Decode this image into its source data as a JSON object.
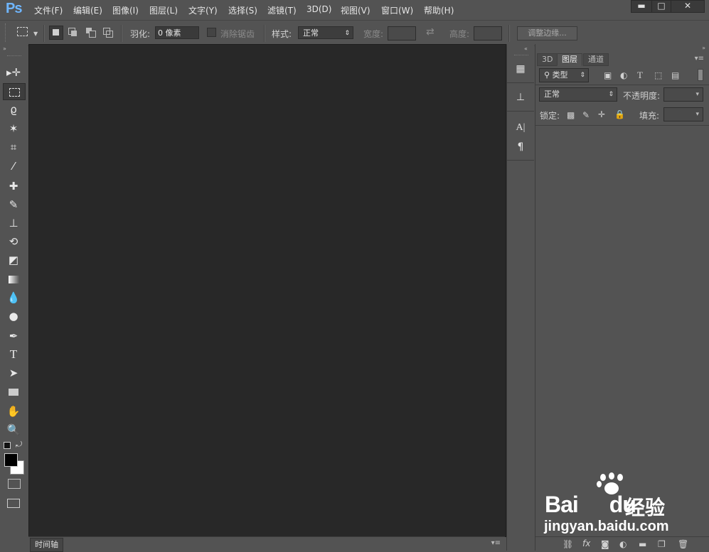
{
  "app": {
    "logo": "Ps"
  },
  "menu": [
    "文件(F)",
    "编辑(E)",
    "图像(I)",
    "图层(L)",
    "文字(Y)",
    "选择(S)",
    "滤镜(T)",
    "3D(D)",
    "视图(V)",
    "窗口(W)",
    "帮助(H)"
  ],
  "window_controls": {
    "minimize": "▬",
    "maximize": "□",
    "close": "✕"
  },
  "options": {
    "feather_label": "羽化:",
    "feather_value": "0 像素",
    "antialias_label": "消除锯齿",
    "style_label": "样式:",
    "style_value": "正常",
    "width_label": "宽度:",
    "height_label": "高度:",
    "refine_edge": "调整边缘..."
  },
  "timeline": {
    "tab": "时间轴"
  },
  "panel": {
    "tabs": [
      "3D",
      "图层",
      "通道"
    ],
    "active_tab": "图层",
    "filter_kind": "类型",
    "blend_mode": "正常",
    "opacity_label": "不透明度:",
    "lock_label": "锁定:",
    "fill_label": "填充:"
  },
  "watermark": {
    "brand": "Bai",
    "brand2": "du",
    "cn": "经验",
    "url": "jingyan.baidu.com"
  },
  "icons": {
    "tools": [
      "move-icon",
      "marquee-icon",
      "lasso-icon",
      "magic-wand-icon",
      "crop-icon",
      "eyedropper-icon",
      "healing-icon",
      "brush-icon",
      "stamp-icon",
      "history-brush-icon",
      "eraser-icon",
      "gradient-icon",
      "blur-icon",
      "dodge-icon",
      "pen-icon",
      "type-icon",
      "path-select-icon",
      "rectangle-icon",
      "hand-icon",
      "zoom-icon"
    ]
  },
  "colors": {
    "background": "#535353",
    "canvas": "#282828",
    "accent": "#6fb6ff"
  }
}
